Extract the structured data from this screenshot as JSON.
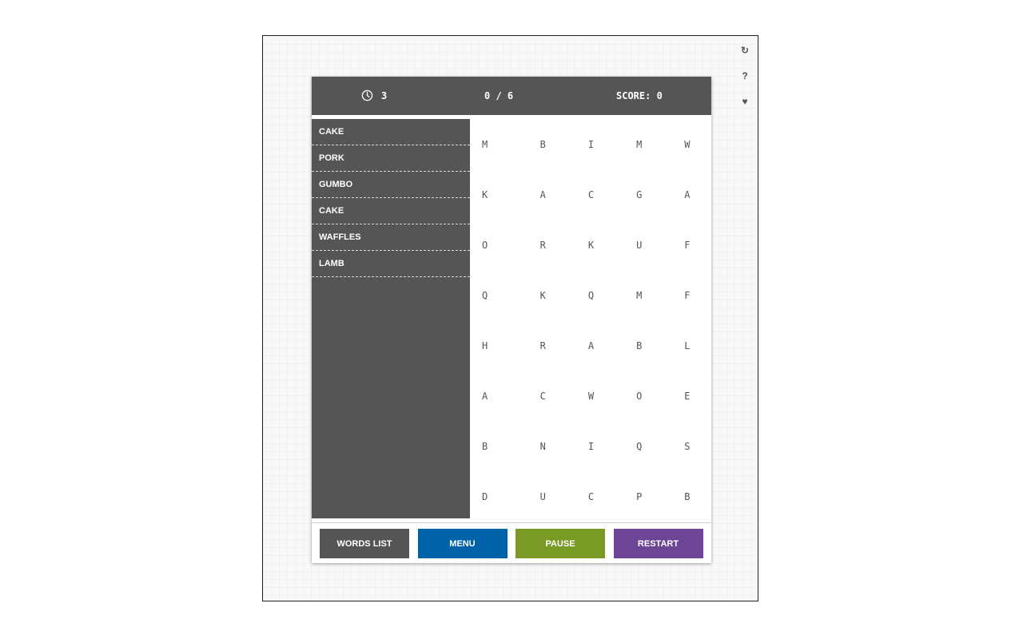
{
  "side_icons": {
    "refresh_glyph": "↻",
    "help_glyph": "?",
    "heart_glyph": "♥"
  },
  "topbar": {
    "time": "3",
    "progress": "0 / 6",
    "score": "SCORE: 0"
  },
  "words": [
    "CAKE",
    "PORK",
    "GUMBO",
    "CAKE",
    "WAFFLES",
    "LAMB"
  ],
  "grid": [
    [
      "M",
      "B",
      "I",
      "M",
      "W"
    ],
    [
      "K",
      "A",
      "C",
      "G",
      "A"
    ],
    [
      "O",
      "R",
      "K",
      "U",
      "F"
    ],
    [
      "Q",
      "K",
      "Q",
      "M",
      "F"
    ],
    [
      "H",
      "R",
      "A",
      "B",
      "L"
    ],
    [
      "A",
      "C",
      "W",
      "O",
      "E"
    ],
    [
      "B",
      "N",
      "I",
      "Q",
      "S"
    ],
    [
      "D",
      "U",
      "C",
      "P",
      "B"
    ]
  ],
  "buttons": [
    {
      "label": "WORDS LIST",
      "color": "#555555"
    },
    {
      "label": "MENU",
      "color": "#0062a8"
    },
    {
      "label": "PAUSE",
      "color": "#7a9a26"
    },
    {
      "label": "RESTART",
      "color": "#6c4596"
    }
  ]
}
